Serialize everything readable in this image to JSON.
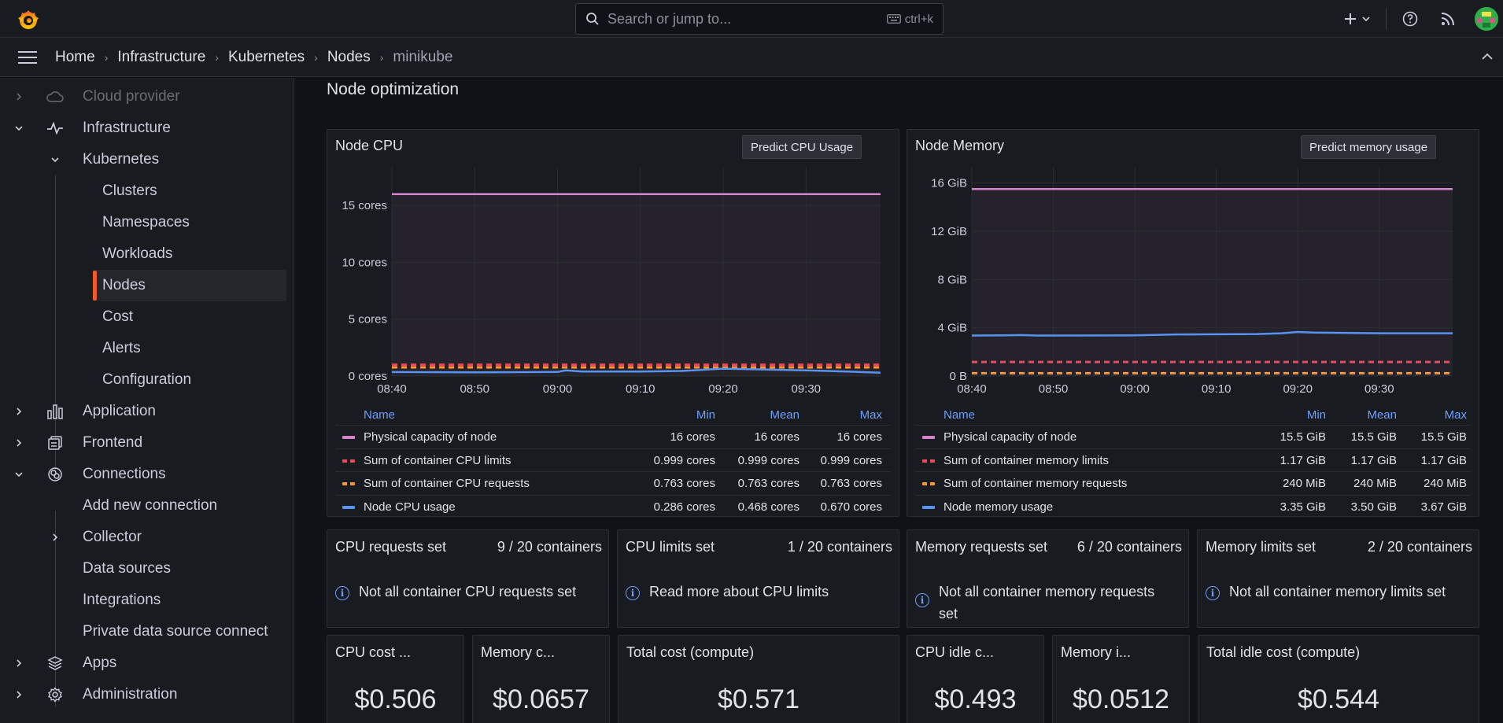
{
  "topbar": {
    "search_placeholder": "Search or jump to...",
    "search_shortcut": "ctrl+k",
    "icons": [
      "grafana-logo-icon",
      "search-icon",
      "keyboard-icon",
      "plus-icon",
      "chevron-down-icon",
      "help-icon",
      "news-icon",
      "avatar"
    ]
  },
  "breadcrumbs": [
    "Home",
    "Infrastructure",
    "Kubernetes",
    "Nodes",
    "minikube"
  ],
  "sidebar": {
    "items": [
      {
        "label": "Cloud provider",
        "icon": "cloud-icon"
      },
      {
        "label": "Infrastructure",
        "icon": "heartbeat-icon"
      },
      {
        "label": "Kubernetes"
      },
      {
        "label": "Clusters"
      },
      {
        "label": "Namespaces"
      },
      {
        "label": "Workloads"
      },
      {
        "label": "Nodes"
      },
      {
        "label": "Cost"
      },
      {
        "label": "Alerts"
      },
      {
        "label": "Configuration"
      },
      {
        "label": "Application",
        "icon": "bar-chart-icon"
      },
      {
        "label": "Frontend",
        "icon": "frontend-icon"
      },
      {
        "label": "Connections",
        "icon": "connections-icon"
      },
      {
        "label": "Add new connection"
      },
      {
        "label": "Collector"
      },
      {
        "label": "Data sources"
      },
      {
        "label": "Integrations"
      },
      {
        "label": "Private data source connect"
      },
      {
        "label": "Apps",
        "icon": "layers-icon"
      },
      {
        "label": "Administration",
        "icon": "gear-icon"
      }
    ]
  },
  "main": {
    "section_title": "Node optimization",
    "cpu_panel": {
      "title": "Node CPU",
      "button": "Predict CPU Usage",
      "legend_headers": {
        "name": "Name",
        "min": "Min",
        "mean": "Mean",
        "max": "Max"
      },
      "rows": [
        {
          "name": "Physical capacity of node",
          "min": "16 cores",
          "mean": "16 cores",
          "max": "16 cores",
          "color": "#d683ce",
          "style": "solid"
        },
        {
          "name": "Sum of container CPU limits",
          "min": "0.999 cores",
          "mean": "0.999 cores",
          "max": "0.999 cores",
          "color": "#f2495c",
          "style": "dash"
        },
        {
          "name": "Sum of container CPU requests",
          "min": "0.763 cores",
          "mean": "0.763 cores",
          "max": "0.763 cores",
          "color": "#ff9830",
          "style": "dash"
        },
        {
          "name": "Node CPU usage",
          "min": "0.286 cores",
          "mean": "0.468 cores",
          "max": "0.670 cores",
          "color": "#5794f2",
          "style": "solid"
        }
      ]
    },
    "memory_panel": {
      "title": "Node Memory",
      "button": "Predict memory usage",
      "legend_headers": {
        "name": "Name",
        "min": "Min",
        "mean": "Mean",
        "max": "Max"
      },
      "rows": [
        {
          "name": "Physical capacity of node",
          "min": "15.5 GiB",
          "mean": "15.5 GiB",
          "max": "15.5 GiB",
          "color": "#d683ce",
          "style": "solid"
        },
        {
          "name": "Sum of container memory limits",
          "min": "1.17 GiB",
          "mean": "1.17 GiB",
          "max": "1.17 GiB",
          "color": "#f2495c",
          "style": "dash"
        },
        {
          "name": "Sum of container memory requests",
          "min": "240 MiB",
          "mean": "240 MiB",
          "max": "240 MiB",
          "color": "#ff9830",
          "style": "dash"
        },
        {
          "name": "Node memory usage",
          "min": "3.35 GiB",
          "mean": "3.50 GiB",
          "max": "3.67 GiB",
          "color": "#5794f2",
          "style": "solid"
        }
      ]
    },
    "stats": [
      {
        "title": "CPU requests set",
        "value": "9 / 20 containers",
        "note": "Not all container CPU requests set"
      },
      {
        "title": "CPU limits set",
        "value": "1 / 20 containers",
        "note": "Read more about CPU limits"
      },
      {
        "title": "Memory requests set",
        "value": "6 / 20 containers",
        "note": "Not all container memory requests set"
      },
      {
        "title": "Memory limits set",
        "value": "2 / 20 containers",
        "note": "Not all container memory limits set"
      }
    ],
    "costs": [
      {
        "title": "CPU cost ...",
        "value": "$0.506"
      },
      {
        "title": "Memory c...",
        "value": "$0.0657"
      },
      {
        "title": "Total cost (compute)",
        "value": "$0.571"
      },
      {
        "title": "CPU idle c...",
        "value": "$0.493"
      },
      {
        "title": "Memory i...",
        "value": "$0.0512"
      },
      {
        "title": "Total idle cost (compute)",
        "value": "$0.544"
      }
    ]
  },
  "chart_data": [
    {
      "type": "line",
      "title": "Node CPU",
      "x": [
        "08:40",
        "08:50",
        "09:00",
        "09:10",
        "09:20",
        "09:30"
      ],
      "y_ticks": [
        "0 cores",
        "5 cores",
        "10 cores",
        "15 cores"
      ],
      "ylim": [
        0,
        17.5
      ],
      "xlim": [
        "08:40",
        "09:39"
      ],
      "grid": true,
      "legend": "bottom",
      "series": [
        {
          "name": "Physical capacity of node",
          "color": "#d683ce",
          "style": "solid",
          "points": [
            [
              "08:40",
              16
            ],
            [
              "09:39",
              16
            ]
          ]
        },
        {
          "name": "Sum of container CPU limits",
          "color": "#f2495c",
          "style": "dash",
          "points": [
            [
              "08:40",
              0.999
            ],
            [
              "09:39",
              0.999
            ]
          ]
        },
        {
          "name": "Sum of container CPU requests",
          "color": "#ff9830",
          "style": "dash",
          "points": [
            [
              "08:40",
              0.763
            ],
            [
              "09:39",
              0.763
            ]
          ]
        },
        {
          "name": "Node CPU usage",
          "color": "#5794f2",
          "style": "solid",
          "points": [
            [
              "08:40",
              0.35
            ],
            [
              "08:50",
              0.33
            ],
            [
              "09:00",
              0.36
            ],
            [
              "09:01",
              0.5
            ],
            [
              "09:03",
              0.4
            ],
            [
              "09:10",
              0.4
            ],
            [
              "09:15",
              0.45
            ],
            [
              "09:20",
              0.65
            ],
            [
              "09:23",
              0.6
            ],
            [
              "09:30",
              0.5
            ],
            [
              "09:35",
              0.4
            ],
            [
              "09:39",
              0.3
            ]
          ]
        }
      ]
    },
    {
      "type": "line",
      "title": "Node Memory",
      "x": [
        "08:40",
        "08:50",
        "09:00",
        "09:10",
        "09:20",
        "09:30"
      ],
      "y_ticks": [
        "0 B",
        "4 GiB",
        "8 GiB",
        "12 GiB",
        "16 GiB"
      ],
      "ylim": [
        0,
        16.5
      ],
      "xlim": [
        "08:40",
        "09:39"
      ],
      "grid": true,
      "legend": "bottom",
      "series": [
        {
          "name": "Physical capacity of node",
          "color": "#d683ce",
          "style": "solid",
          "points": [
            [
              "08:40",
              15.5
            ],
            [
              "09:39",
              15.5
            ]
          ]
        },
        {
          "name": "Sum of container memory limits",
          "color": "#f2495c",
          "style": "dash",
          "points": [
            [
              "08:40",
              1.17
            ],
            [
              "09:39",
              1.17
            ]
          ]
        },
        {
          "name": "Sum of container memory requests",
          "color": "#ff9830",
          "style": "dash",
          "points": [
            [
              "08:40",
              0.234
            ],
            [
              "09:39",
              0.234
            ]
          ]
        },
        {
          "name": "Node memory usage",
          "color": "#5794f2",
          "style": "solid",
          "points": [
            [
              "08:40",
              3.36
            ],
            [
              "08:44",
              3.38
            ],
            [
              "08:46",
              3.4
            ],
            [
              "08:48",
              3.36
            ],
            [
              "09:00",
              3.37
            ],
            [
              "09:05",
              3.45
            ],
            [
              "09:10",
              3.46
            ],
            [
              "09:15",
              3.48
            ],
            [
              "09:18",
              3.55
            ],
            [
              "09:20",
              3.65
            ],
            [
              "09:22",
              3.6
            ],
            [
              "09:30",
              3.55
            ],
            [
              "09:39",
              3.55
            ]
          ]
        }
      ]
    }
  ]
}
